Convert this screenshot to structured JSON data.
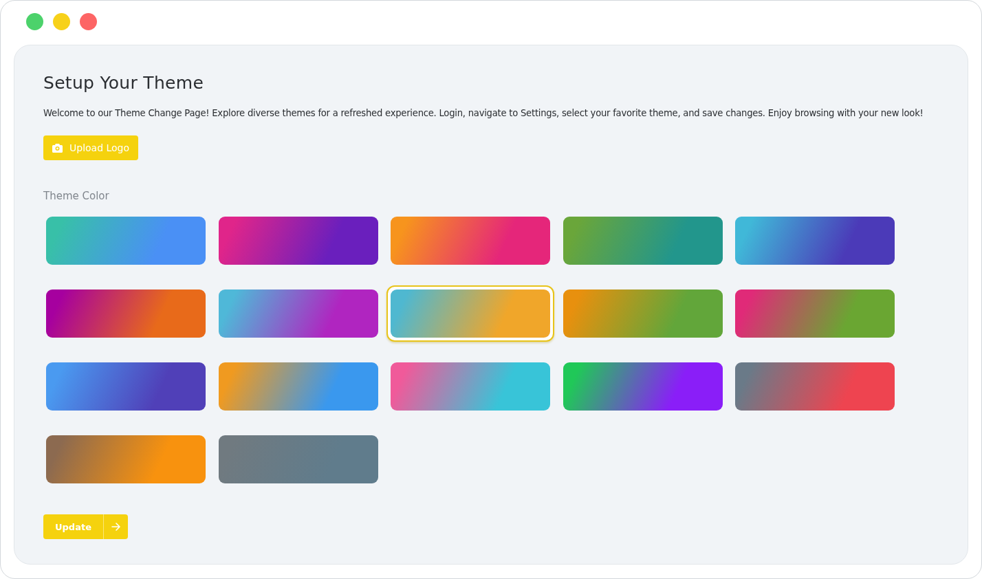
{
  "title": "Setup Your Theme",
  "description": "Welcome to our Theme Change Page! Explore diverse themes for a refreshed experience. Login, navigate to Settings, select your favorite theme, and save changes. Enjoy browsing with your new look!",
  "upload_button": "Upload Logo",
  "section_label": "Theme Color",
  "swatches": [
    {
      "stops": [
        {
          "color": "#38c0a8"
        },
        {
          "color": "#4a90f5"
        }
      ],
      "selected": false
    },
    {
      "stops": [
        {
          "color": "#e0258a"
        },
        {
          "color": "#6a1fbd"
        }
      ],
      "selected": false
    },
    {
      "stops": [
        {
          "color": "#f7941d"
        },
        {
          "color": "#e5267a"
        }
      ],
      "selected": false
    },
    {
      "stops": [
        {
          "color": "#6aa63a"
        },
        {
          "color": "#22968c"
        }
      ],
      "selected": false
    },
    {
      "stops": [
        {
          "color": "#40b8d8"
        },
        {
          "color": "#4b3ab8"
        }
      ],
      "selected": false
    },
    {
      "stops": [
        {
          "color": "#a6009f"
        },
        {
          "color": "#e86a1a"
        }
      ],
      "selected": false
    },
    {
      "stops": [
        {
          "color": "#4fb8d8"
        },
        {
          "color": "#b025c0"
        }
      ],
      "selected": false
    },
    {
      "stops": [
        {
          "color": "#4fb8d0"
        },
        {
          "color": "#f0a62a"
        }
      ],
      "selected": true
    },
    {
      "stops": [
        {
          "color": "#e8900e"
        },
        {
          "color": "#62a63a"
        }
      ],
      "selected": false
    },
    {
      "stops": [
        {
          "color": "#e02a78"
        },
        {
          "color": "#6aa632"
        }
      ],
      "selected": false
    },
    {
      "stops": [
        {
          "color": "#4a9af0"
        },
        {
          "color": "#5040b8"
        }
      ],
      "selected": false
    },
    {
      "stops": [
        {
          "color": "#f09a20"
        },
        {
          "color": "#3a98ee"
        }
      ],
      "selected": false
    },
    {
      "stops": [
        {
          "color": "#f05a9a"
        },
        {
          "color": "#38c4d8"
        }
      ],
      "selected": false
    },
    {
      "stops": [
        {
          "color": "#20c858"
        },
        {
          "color": "#8a1ef8"
        }
      ],
      "selected": false
    },
    {
      "stops": [
        {
          "color": "#6a7a88"
        },
        {
          "color": "#ee4450"
        }
      ],
      "selected": false
    },
    {
      "stops": [
        {
          "color": "#8c6a50"
        },
        {
          "color": "#f8920e"
        }
      ],
      "selected": false
    },
    {
      "stops": [
        {
          "color": "#707a80"
        },
        {
          "color": "#607c8c"
        }
      ],
      "selected": false
    }
  ],
  "update_button": "Update"
}
